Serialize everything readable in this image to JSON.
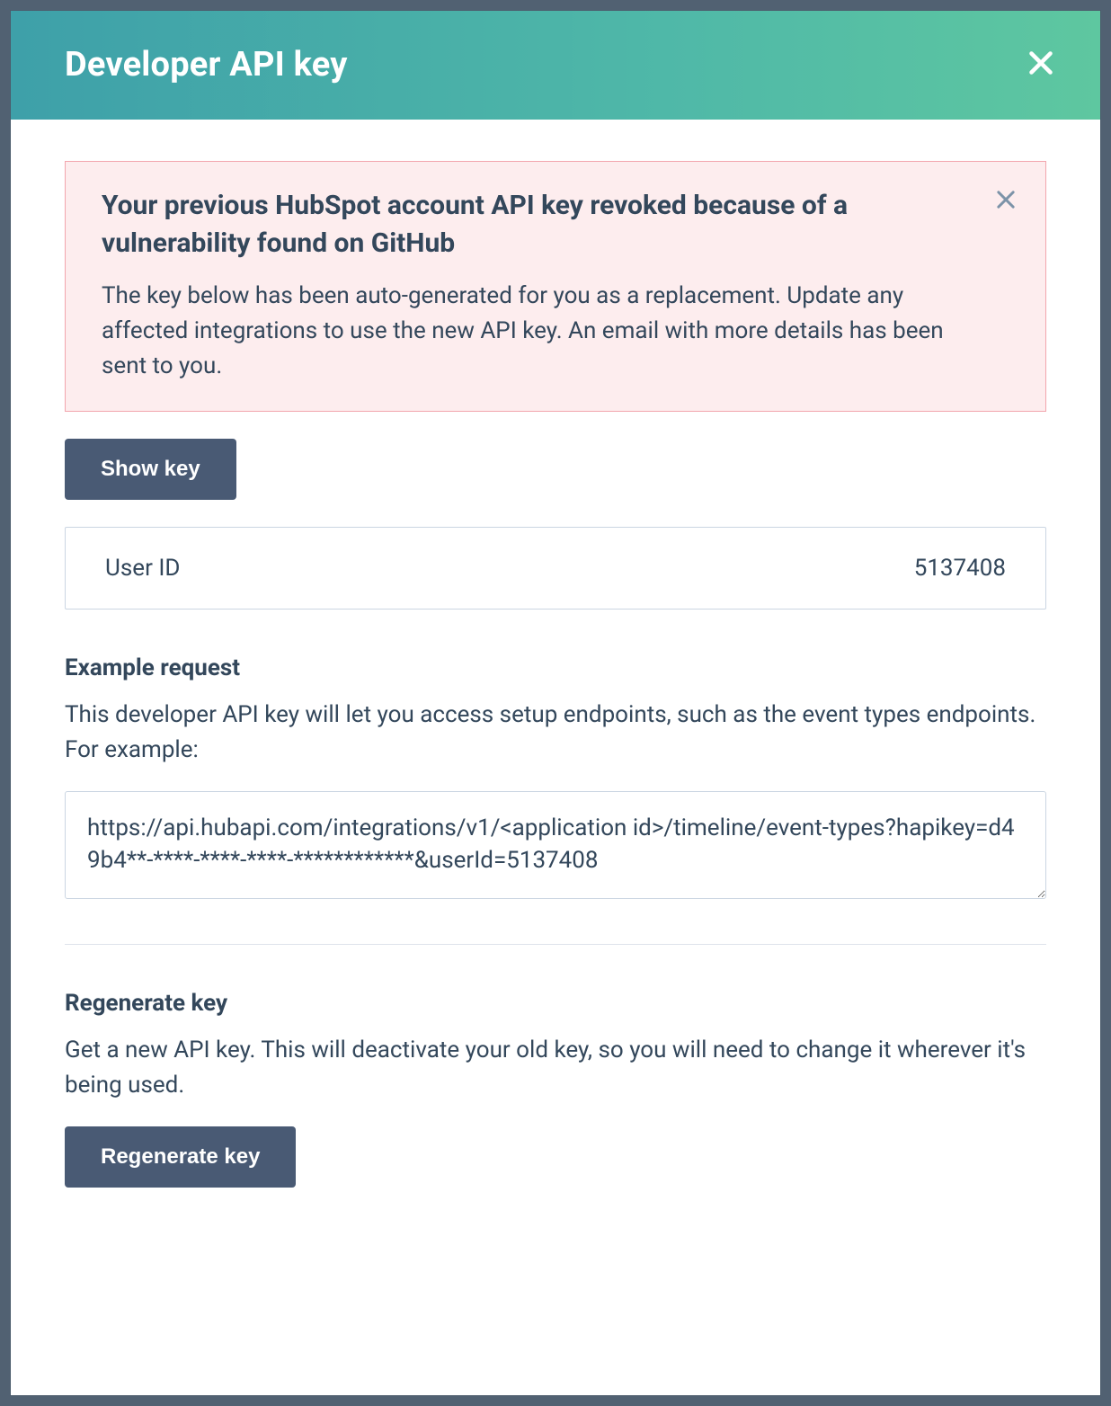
{
  "modal": {
    "title": "Developer API key"
  },
  "alert": {
    "title": "Your previous HubSpot account API key revoked because of a vulnerability found on GitHub",
    "body": "The key below has been auto-generated for you as a replacement. Update any affected integrations to use the new API key. An email with more details has been sent to you."
  },
  "buttons": {
    "show_key": "Show key",
    "regenerate": "Regenerate key"
  },
  "user": {
    "label": "User ID",
    "value": "5137408"
  },
  "example": {
    "title": "Example request",
    "desc": "This developer API key will let you access setup endpoints, such as the event types endpoints. For example:",
    "code": "https://api.hubapi.com/integrations/v1/<application id>/timeline/event-types?hapikey=d49b4**-****-****-****-************&userId=5137408"
  },
  "regenerate": {
    "title": "Regenerate key",
    "desc": "Get a new API key. This will deactivate your old key, so you will need to change it wherever it's being used."
  }
}
